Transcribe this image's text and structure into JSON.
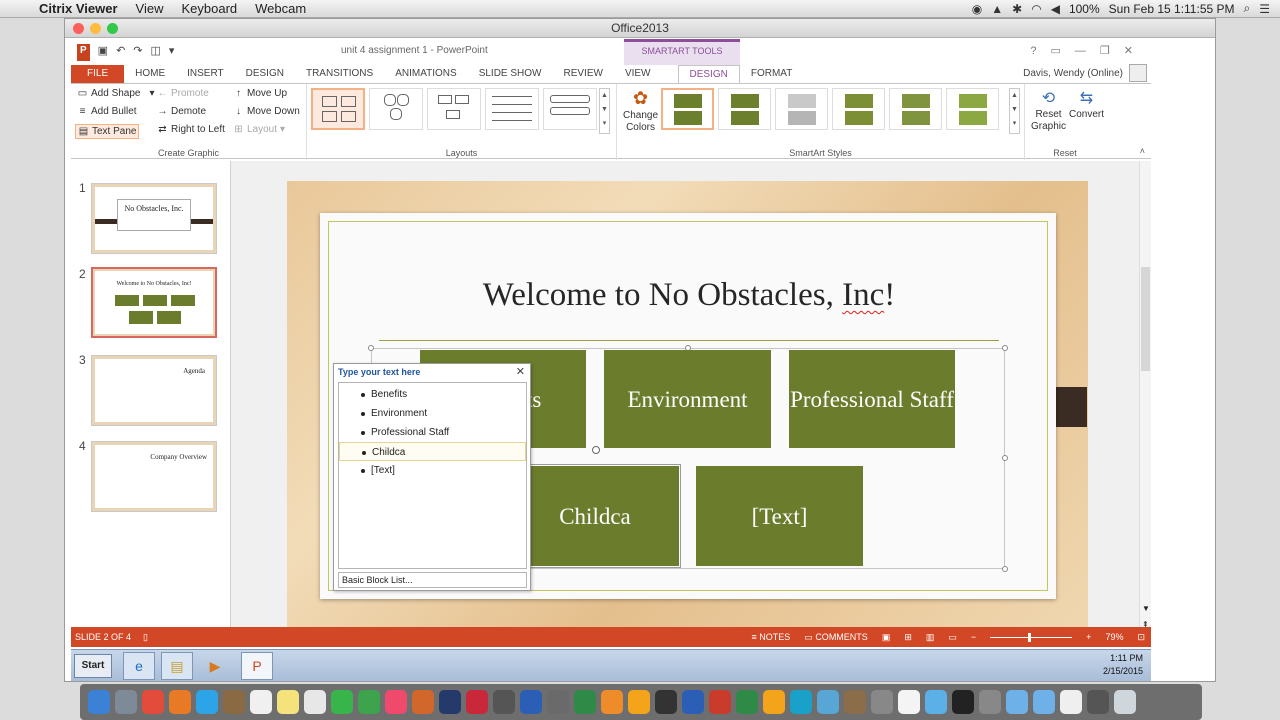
{
  "mac_menubar": {
    "app": "Citrix Viewer",
    "menus": [
      "View",
      "Keyboard",
      "Webcam"
    ],
    "battery": "100%",
    "clock": "Sun Feb 15  1:11:55 PM"
  },
  "citrix_window": {
    "title": "Office2013"
  },
  "ppt": {
    "document_title": "unit 4 assignment 1 - PowerPoint",
    "tools_label": "SMARTART TOOLS",
    "tabs": [
      "FILE",
      "HOME",
      "INSERT",
      "DESIGN",
      "TRANSITIONS",
      "ANIMATIONS",
      "SLIDE SHOW",
      "REVIEW",
      "VIEW"
    ],
    "tool_tabs": [
      "DESIGN",
      "FORMAT"
    ],
    "user": "Davis, Wendy (Online)",
    "create_graphic": {
      "label": "Create Graphic",
      "add_shape": "Add Shape",
      "add_bullet": "Add Bullet",
      "text_pane": "Text Pane",
      "promote": "Promote",
      "demote": "Demote",
      "right_to_left": "Right to Left",
      "move_up": "Move Up",
      "move_down": "Move Down",
      "layout": "Layout"
    },
    "layouts_label": "Layouts",
    "change_colors": [
      "Change",
      "Colors"
    ],
    "smartart_styles_label": "SmartArt Styles",
    "reset": {
      "label": "Reset",
      "reset_graphic": [
        "Reset",
        "Graphic"
      ],
      "convert": "Convert"
    }
  },
  "slides_panel": {
    "numbers": [
      "1",
      "2",
      "3",
      "4"
    ],
    "thumb1_title": "No Obstacles, Inc.",
    "thumb2_title": "Welcome to No Obstacles, Inc!",
    "thumb3_title": "Agenda",
    "thumb4_title": "Company Overview"
  },
  "slide": {
    "title_a": "Welcome to No Obstacles, ",
    "title_b": "Inc",
    "title_c": "!",
    "blocks": [
      "Benefits",
      "Environment",
      "Professional Staff",
      "Childca",
      "[Text]"
    ]
  },
  "text_pane": {
    "header": "Type your text here",
    "items": [
      "Benefits",
      "Environment",
      "Professional Staff",
      "Childca",
      "[Text]"
    ],
    "footer": "Basic Block List..."
  },
  "statusbar": {
    "slide_of": "SLIDE 2 OF 4",
    "notes": "NOTES",
    "comments": "COMMENTS",
    "zoom": "79%"
  },
  "taskbar": {
    "start": "Start",
    "time": "1:11 PM",
    "date": "2/15/2015"
  },
  "colors": {
    "ppt_accent": "#d24726",
    "smartart_green": "#6b7c2c",
    "tools_purple": "#8d4e9b"
  }
}
